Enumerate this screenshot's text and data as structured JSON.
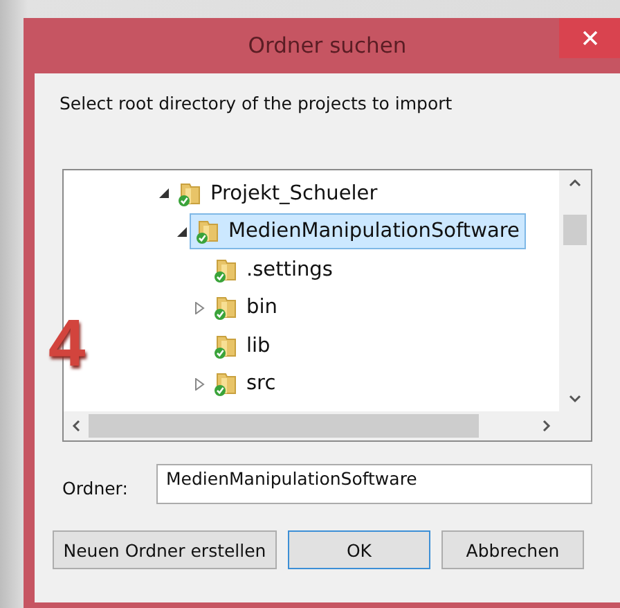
{
  "window": {
    "title": "Ordner suchen"
  },
  "instruction": "Select root directory of the projects to import",
  "step_marker": "4",
  "tree": [
    {
      "label": "Projekt_Schueler",
      "kind": "branch",
      "expanded": true,
      "selected": false,
      "children": [
        {
          "label": "MedienManipulationSoftware",
          "kind": "branch",
          "expanded": true,
          "selected": true,
          "children": [
            {
              "label": ".settings",
              "kind": "leaf",
              "selected": false
            },
            {
              "label": "bin",
              "kind": "branch",
              "expanded": false,
              "selected": false
            },
            {
              "label": "lib",
              "kind": "leaf",
              "selected": false
            },
            {
              "label": "src",
              "kind": "branch",
              "expanded": false,
              "selected": false
            }
          ]
        }
      ]
    }
  ],
  "folder_field": {
    "label": "Ordner:",
    "value": "MedienManipulationSoftware"
  },
  "buttons": [
    {
      "label": "Neuen Ordner erstellen",
      "default": false
    },
    {
      "label": "OK",
      "default": true
    },
    {
      "label": "Abbrechen",
      "default": false
    }
  ]
}
